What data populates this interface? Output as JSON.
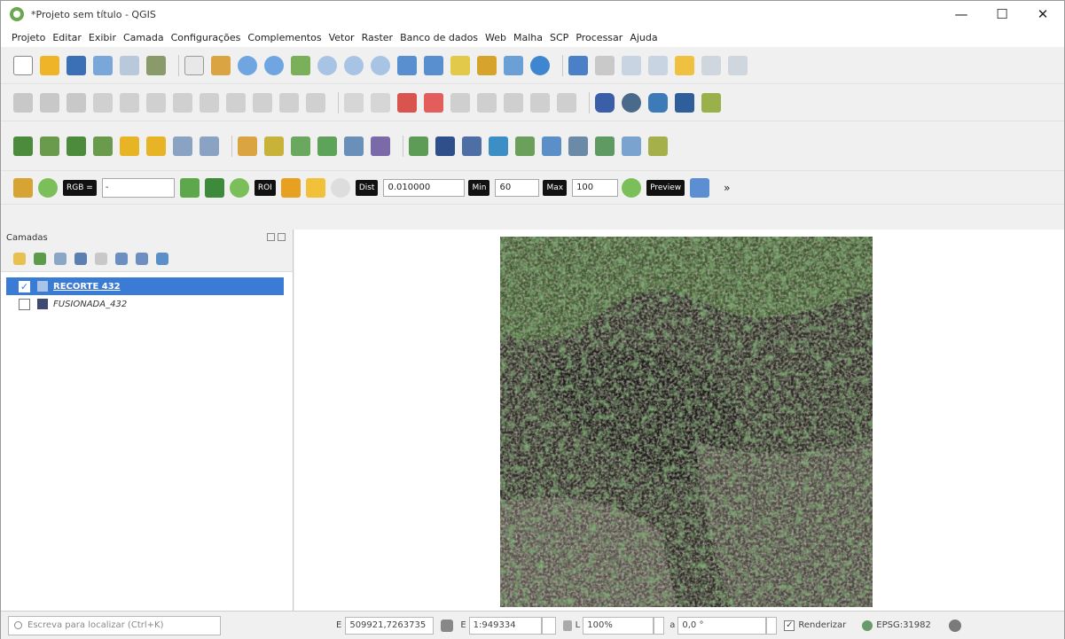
{
  "window": {
    "title": "*Projeto sem título - QGIS",
    "minimize": "—",
    "maximize": "☐",
    "close": "✕"
  },
  "menu": [
    "Projeto",
    "Editar",
    "Exibir",
    "Camada",
    "Configurações",
    "Complementos",
    "Vetor",
    "Raster",
    "Banco de dados",
    "Web",
    "Malha",
    "SCP",
    "Processar",
    "Ajuda"
  ],
  "scp_toolbar": {
    "rgb_label": "RGB =",
    "rgb_value": "-",
    "roi_label": "ROI",
    "dist_label": "Dist",
    "dist_value": "0.010000",
    "min_label": "Min",
    "min_value": "60",
    "max_label": "Max",
    "max_value": "100",
    "preview_label": "Preview",
    "more": "»"
  },
  "layers_panel": {
    "title": "Camadas",
    "layers": [
      {
        "name": "RECORTE 432",
        "checked": true,
        "selected": true
      },
      {
        "name": "FUSIONADA_432",
        "checked": false,
        "selected": false
      }
    ]
  },
  "statusbar": {
    "locator_placeholder": "Escreva para localizar (Ctrl+K)",
    "coord_label": "E",
    "coordinate": "509921,7263735",
    "scale_label": "E",
    "scale": "1:949334",
    "magnifier_label": "L",
    "magnifier": "100%",
    "rotation_label": "a",
    "rotation": "0,0 °",
    "render_label": "Renderizar",
    "crs": "EPSG:31982"
  },
  "colors": {
    "selection": "#3a7bd5",
    "accent_green": "#4caf50"
  }
}
